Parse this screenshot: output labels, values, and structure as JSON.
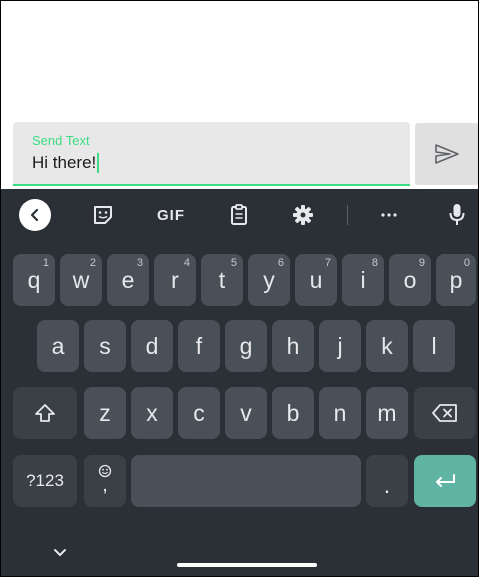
{
  "field": {
    "label": "Send Text",
    "value": "Hi there!"
  },
  "keyboard": {
    "toolbar": {
      "gif_label": "GIF"
    },
    "rows": [
      [
        {
          "label": "q",
          "hint": "1"
        },
        {
          "label": "w",
          "hint": "2"
        },
        {
          "label": "e",
          "hint": "3"
        },
        {
          "label": "r",
          "hint": "4"
        },
        {
          "label": "t",
          "hint": "5"
        },
        {
          "label": "y",
          "hint": "6"
        },
        {
          "label": "u",
          "hint": "7"
        },
        {
          "label": "i",
          "hint": "8"
        },
        {
          "label": "o",
          "hint": "9"
        },
        {
          "label": "p",
          "hint": "0"
        }
      ],
      [
        {
          "label": "a"
        },
        {
          "label": "s"
        },
        {
          "label": "d"
        },
        {
          "label": "f"
        },
        {
          "label": "g"
        },
        {
          "label": "h"
        },
        {
          "label": "j"
        },
        {
          "label": "k"
        },
        {
          "label": "l"
        }
      ],
      [
        {
          "label": "z"
        },
        {
          "label": "x"
        },
        {
          "label": "c"
        },
        {
          "label": "v"
        },
        {
          "label": "b"
        },
        {
          "label": "n"
        },
        {
          "label": "m"
        }
      ]
    ],
    "symbols_label": "?123",
    "comma_label": ",",
    "period_label": "."
  },
  "colors": {
    "accent": "#3ddc84",
    "keyboard_bg": "#2b3036",
    "key_bg": "#4a5058",
    "enter_bg": "#5fb4a3"
  }
}
